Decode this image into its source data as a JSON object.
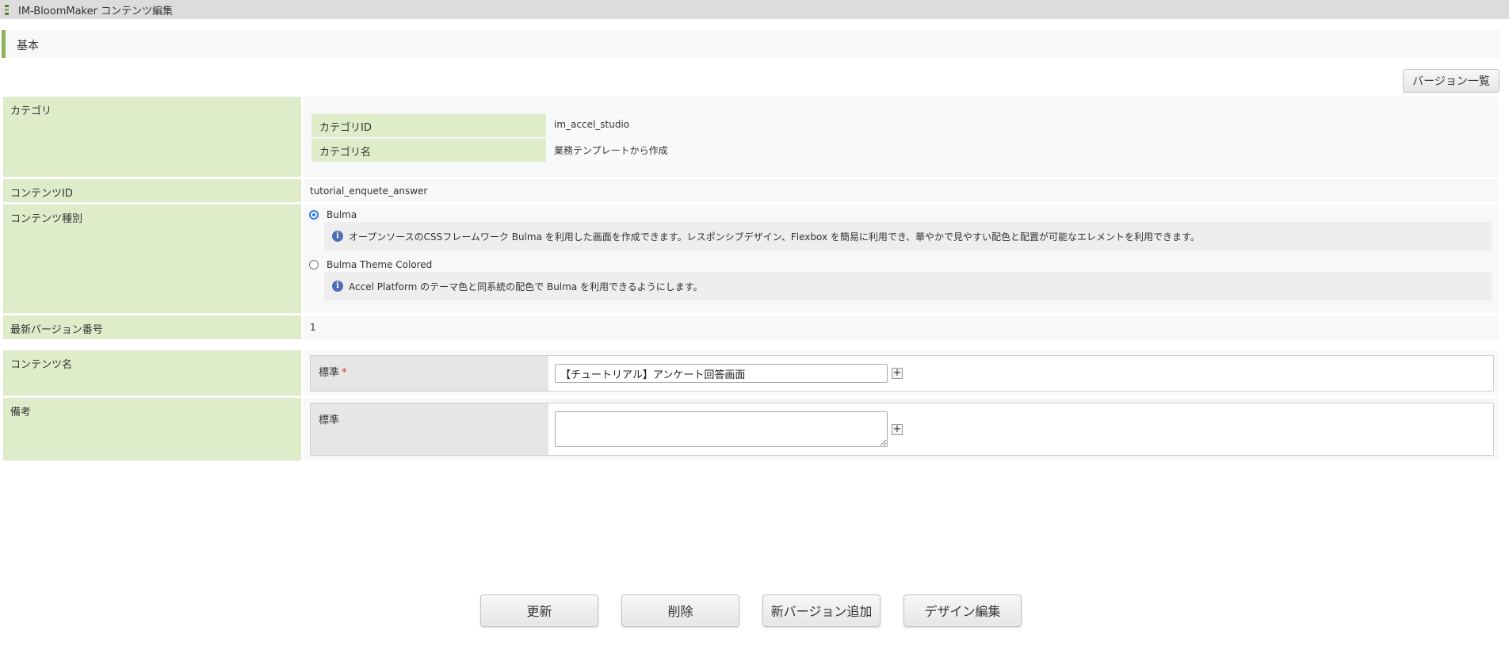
{
  "window": {
    "title": "IM-BloomMaker コンテンツ編集"
  },
  "section": {
    "title": "基本"
  },
  "toolbar": {
    "version_list_label": "バージョン一覧"
  },
  "category": {
    "label": "カテゴリ",
    "id_label": "カテゴリID",
    "id_value": "im_accel_studio",
    "name_label": "カテゴリ名",
    "name_value": "業務テンプレートから作成"
  },
  "content_id": {
    "label": "コンテンツID",
    "value": "tutorial_enquete_answer"
  },
  "content_type": {
    "label": "コンテンツ種別",
    "options": [
      {
        "label": "Bulma",
        "selected": true,
        "info": "オープンソースのCSSフレームワーク Bulma を利用した画面を作成できます。レスポンシブデザイン、Flexbox を簡易に利用でき、華やかで見やすい配色と配置が可能なエレメントを利用できます。"
      },
      {
        "label": "Bulma Theme Colored",
        "selected": false,
        "info": "Accel Platform のテーマ色と同系統の配色で Bulma を利用できるようにします。"
      }
    ]
  },
  "latest_version": {
    "label": "最新バージョン番号",
    "value": "1"
  },
  "content_name": {
    "label": "コンテンツ名",
    "locale_label": "標準",
    "required_mark": "*",
    "value": "【チュートリアル】アンケート回答画面"
  },
  "remarks": {
    "label": "備考",
    "locale_label": "標準",
    "value": ""
  },
  "add_locale_symbol": "+",
  "actions": {
    "update": "更新",
    "delete": "削除",
    "new_version": "新バージョン追加",
    "design_edit": "デザイン編集"
  },
  "colors": {
    "label_bg": "#deecca",
    "accent": "#8cb357",
    "radio_selected": "#2f7be0",
    "info_icon": "#4d6fb5"
  }
}
